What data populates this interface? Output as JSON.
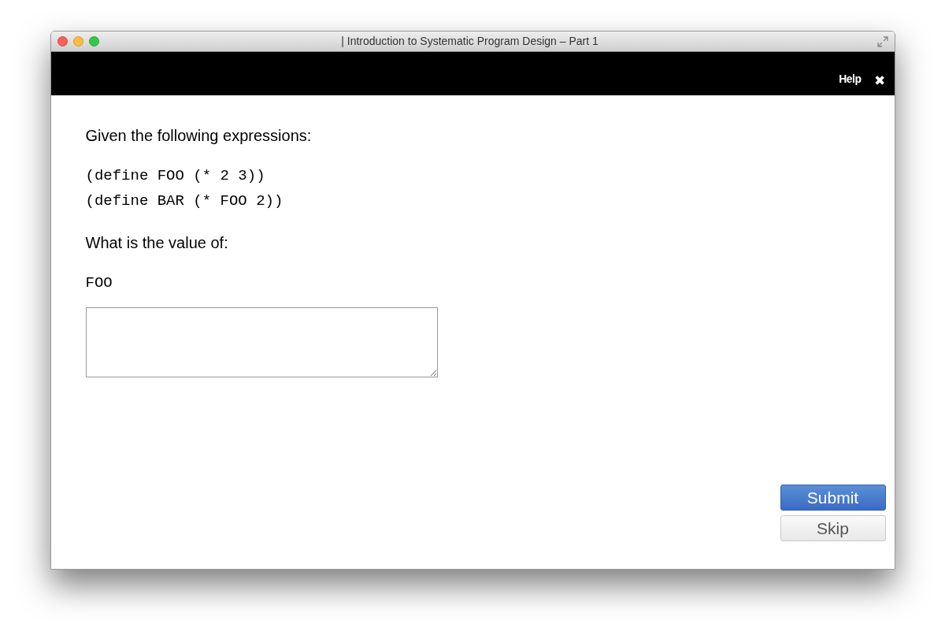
{
  "window": {
    "title": "| Introduction to Systematic Program Design – Part 1"
  },
  "header": {
    "help": "Help",
    "close": "✖"
  },
  "question": {
    "intro": "Given the following expressions:",
    "code": [
      "(define FOO (* 2 3))",
      "(define BAR (* FOO 2))"
    ],
    "prompt": "What is the value of:",
    "expression": "FOO"
  },
  "buttons": [
    {
      "label": "Submit",
      "kind": "primary"
    },
    {
      "label": "Skip",
      "kind": "secondary"
    }
  ]
}
